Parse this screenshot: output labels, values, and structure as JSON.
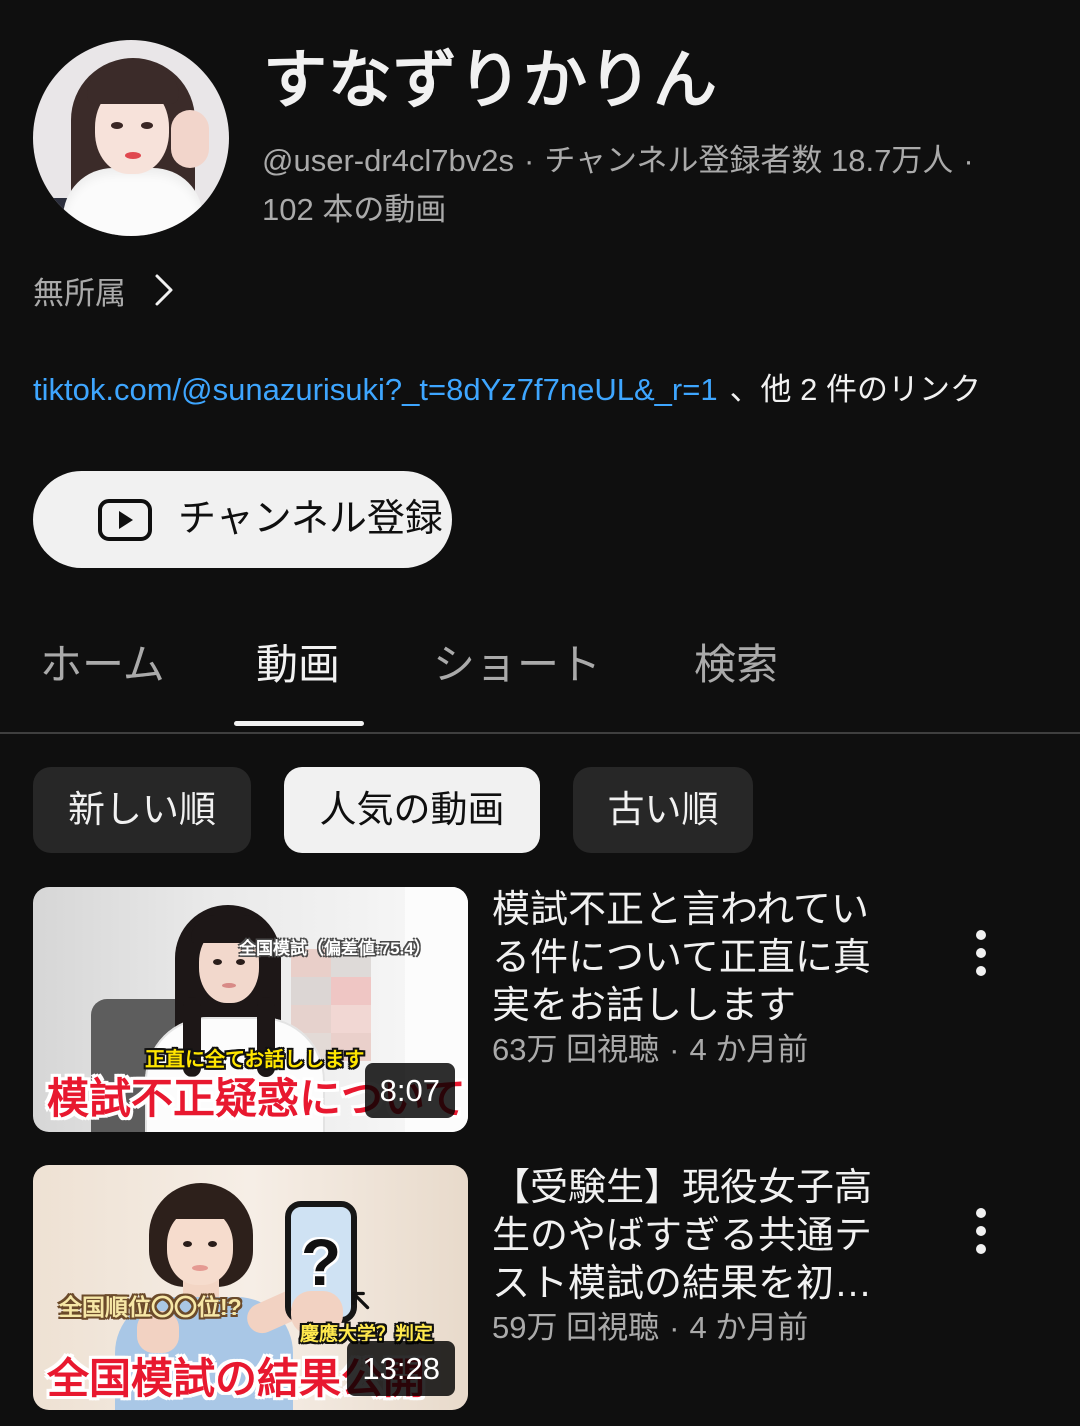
{
  "channel": {
    "name": "すなずりかりん",
    "handle": "@user-dr4cl7bv2s",
    "separator": "·",
    "subscribers": "チャンネル登録者数 18.7万人",
    "video_count": "102 本の動画",
    "affiliation": "無所属",
    "affiliation_icon": "chevron-right-icon",
    "link": "tiktok.com/@sunazurisuki?_t=8dYz7f7neUL&_r=1",
    "more_links": "、他 2 件のリンク"
  },
  "subscribe_button": {
    "label": "チャンネル登録",
    "icon": "youtube-play-icon"
  },
  "tabs": [
    {
      "label": "ホーム",
      "selected": false
    },
    {
      "label": "動画",
      "selected": true
    },
    {
      "label": "ショート",
      "selected": false
    },
    {
      "label": "検索",
      "selected": false
    }
  ],
  "sort_chips": [
    {
      "label": "新しい順",
      "selected": false
    },
    {
      "label": "人気の動画",
      "selected": true
    },
    {
      "label": "古い順",
      "selected": false
    }
  ],
  "videos": [
    {
      "title": "模試不正と言われている件について正直に真実をお話しします",
      "views": "63万 回視聴",
      "separator": "·",
      "age": "4 か月前",
      "duration": "8:07",
      "menu_icon": "more-vert-icon",
      "thumbnail": {
        "caption_top": "全国模試（偏差値:75.4）",
        "caption_mid": "正直に全てお話しします",
        "caption_main": "模試不正疑惑について"
      }
    },
    {
      "title": "【受験生】現役女子高生のやばすぎる共通テスト模試の結果を初…",
      "views": "59万 回視聴",
      "separator": "·",
      "age": "4 か月前",
      "duration": "13:28",
      "menu_icon": "more-vert-icon",
      "thumbnail": {
        "caption_top": "全国順位〇〇位!?",
        "caption_mid": "慶應大学？判定",
        "caption_main": "全国模試の結果公開",
        "phone_mark": "?",
        "arrow_icon": "arrow-up-left-icon"
      }
    }
  ],
  "colors": {
    "background": "#0f0f0f",
    "text": "#f1f1f1",
    "secondary_text": "#aaaaaa",
    "link": "#3ea6ff",
    "chip": "#272727",
    "chip_selected": "#f1f1f1",
    "divider": "#3f3f3f",
    "caption_red": "#e8182f",
    "caption_yellow": "#ffe600"
  }
}
